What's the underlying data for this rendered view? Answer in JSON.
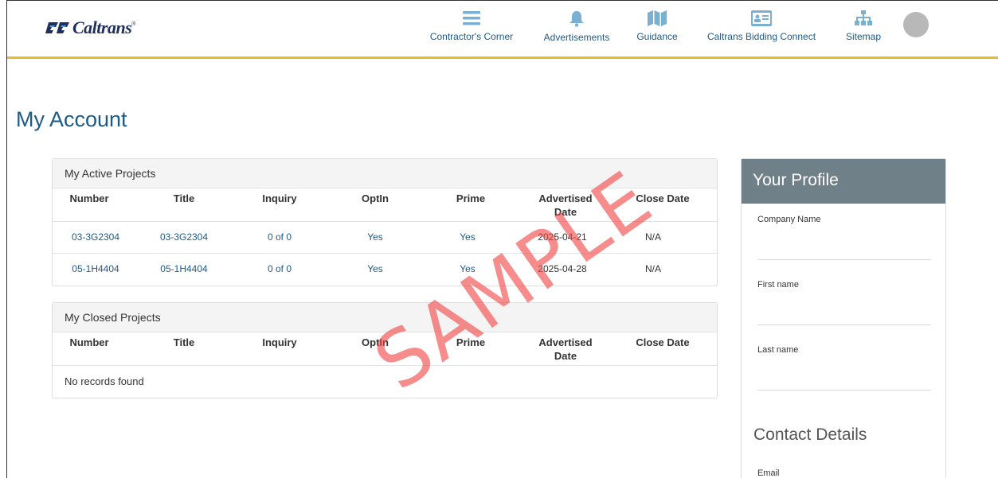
{
  "brand": {
    "logo_text": "Caltrans",
    "logo_reg": "®"
  },
  "nav": [
    {
      "label": "Contractor's Corner",
      "icon": "menu-icon"
    },
    {
      "label": "Advertisements",
      "icon": "bell-icon"
    },
    {
      "label": "Guidance",
      "icon": "map-icon"
    },
    {
      "label": "Caltrans Bidding Connect",
      "icon": "id-card-icon"
    },
    {
      "label": "Sitemap",
      "icon": "sitemap-icon"
    }
  ],
  "page": {
    "title": "My Account"
  },
  "active_projects": {
    "heading": "My Active Projects",
    "columns": [
      "Number",
      "Title",
      "Inquiry",
      "OptIn",
      "Prime",
      "Advertised Date",
      "Close Date"
    ],
    "rows": [
      {
        "number": "03-3G2304",
        "title": "03-3G2304",
        "inquiry": "0 of 0",
        "optin": "Yes",
        "prime": "Yes",
        "advertised": "2025-04-21",
        "close": "N/A"
      },
      {
        "number": "05-1H4404",
        "title": "05-1H4404",
        "inquiry": "0 of 0",
        "optin": "Yes",
        "prime": "Yes",
        "advertised": "2025-04-28",
        "close": "N/A"
      }
    ]
  },
  "closed_projects": {
    "heading": "My Closed Projects",
    "columns": [
      "Number",
      "Title",
      "Inquiry",
      "OptIn",
      "Prime",
      "Advertised Date",
      "Close Date"
    ],
    "empty_text": "No records found"
  },
  "profile": {
    "heading": "Your Profile",
    "fields": [
      {
        "label": "Company Name",
        "value": ""
      },
      {
        "label": "First name",
        "value": ""
      },
      {
        "label": "Last name",
        "value": ""
      }
    ],
    "contact_heading": "Contact Details",
    "contact_fields": [
      {
        "label": "Email",
        "value": ""
      }
    ]
  },
  "watermark": "SAMPLE",
  "colors": {
    "accent_gold": "#e8b92c",
    "link_blue": "#1c5a8a",
    "icon_blue": "#7ab0d4",
    "profile_header": "#6f8088"
  }
}
